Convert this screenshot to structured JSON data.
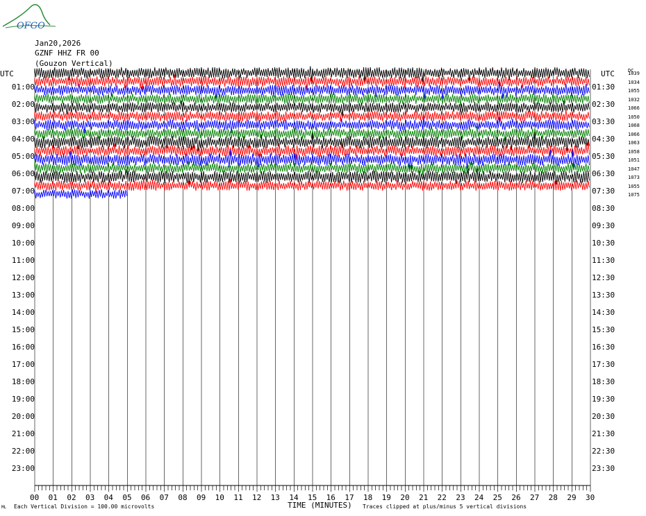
{
  "logo": {
    "text": "OFGO"
  },
  "header": {
    "date": "Jan20,2026",
    "station": "GZNF HHZ FR 00",
    "location": "(Gouzon Vertical)"
  },
  "utc_label_left": "UTC",
  "utc_label_right": "UTC",
  "dc_label": "DC",
  "left_times": [
    "01:00",
    "02:00",
    "03:00",
    "04:00",
    "05:00",
    "06:00",
    "07:00",
    "08:00",
    "09:00",
    "10:00",
    "11:00",
    "12:00",
    "13:00",
    "14:00",
    "15:00",
    "16:00",
    "17:00",
    "18:00",
    "19:00",
    "20:00",
    "21:00",
    "22:00",
    "23:00"
  ],
  "right_times": [
    "01:30",
    "02:30",
    "03:30",
    "04:30",
    "05:30",
    "06:30",
    "07:30",
    "08:30",
    "09:30",
    "10:30",
    "11:30",
    "12:30",
    "13:30",
    "14:30",
    "15:30",
    "16:30",
    "17:30",
    "18:30",
    "19:30",
    "20:30",
    "21:30",
    "22:30",
    "23:30"
  ],
  "dc_values": [
    "1039",
    "1034",
    "1055",
    "1032",
    "1066",
    "1050",
    "1068",
    "1066",
    "1063",
    "1058",
    "1051",
    "1047",
    "1073",
    "1055",
    "1075"
  ],
  "x_ticks": [
    "00",
    "01",
    "02",
    "03",
    "04",
    "05",
    "06",
    "07",
    "08",
    "09",
    "10",
    "11",
    "12",
    "13",
    "14",
    "15",
    "16",
    "17",
    "18",
    "19",
    "20",
    "21",
    "22",
    "23",
    "24",
    "25",
    "26",
    "27",
    "28",
    "29",
    "30"
  ],
  "x_axis_label": "TIME (MINUTES)",
  "footer": {
    "left_mark": "ML",
    "scale": "Each Vertical Division =  100.00 microvolts",
    "clip": "Traces clipped at plus/minus 5 vertical divisions"
  },
  "chart_data": {
    "type": "seismogram",
    "x_range": [
      0,
      30
    ],
    "trace_colors": [
      "#000000",
      "#ff0000",
      "#0000ff",
      "#008000"
    ],
    "traces": [
      {
        "color_index": 0,
        "minutes": 30,
        "amplitude": 0.65
      },
      {
        "color_index": 1,
        "minutes": 30,
        "amplitude": 0.6
      },
      {
        "color_index": 2,
        "minutes": 30,
        "amplitude": 0.6
      },
      {
        "color_index": 3,
        "minutes": 30,
        "amplitude": 0.6
      },
      {
        "color_index": 0,
        "minutes": 30,
        "amplitude": 0.6
      },
      {
        "color_index": 1,
        "minutes": 30,
        "amplitude": 0.6
      },
      {
        "color_index": 2,
        "minutes": 30,
        "amplitude": 0.6
      },
      {
        "color_index": 3,
        "minutes": 30,
        "amplitude": 0.6
      },
      {
        "color_index": 0,
        "minutes": 30,
        "amplitude": 0.7
      },
      {
        "color_index": 1,
        "minutes": 30,
        "amplitude": 0.65
      },
      {
        "color_index": 2,
        "minutes": 30,
        "amplitude": 0.7
      },
      {
        "color_index": 3,
        "minutes": 30,
        "amplitude": 0.6
      },
      {
        "color_index": 0,
        "minutes": 30,
        "amplitude": 0.7
      },
      {
        "color_index": 1,
        "minutes": 30,
        "amplitude": 0.6
      },
      {
        "color_index": 2,
        "minutes": 5,
        "amplitude": 0.55
      }
    ]
  }
}
